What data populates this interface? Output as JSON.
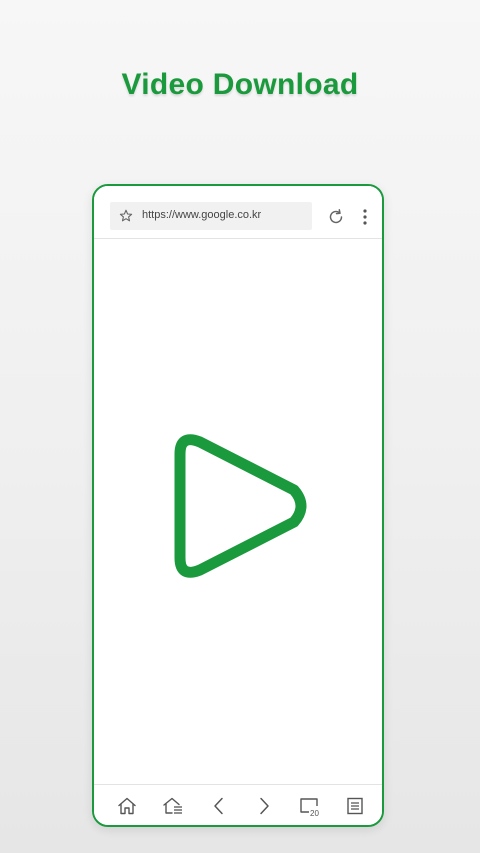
{
  "headline": "Video Download",
  "colors": {
    "accent": "#1a9a3c",
    "icon": "#555555"
  },
  "browser": {
    "url": "https://www.google.co.kr"
  },
  "icons": {
    "bookmark": "star-icon",
    "reload": "reload-icon",
    "menu": "more-vertical-icon",
    "content": "play-icon",
    "home": "home-icon",
    "home_list": "home-list-icon",
    "back": "chevron-left-icon",
    "forward": "chevron-right-icon",
    "tabs": "tabs-icon",
    "list": "list-icon"
  },
  "bottom_bar": {
    "tab_count": "20"
  }
}
